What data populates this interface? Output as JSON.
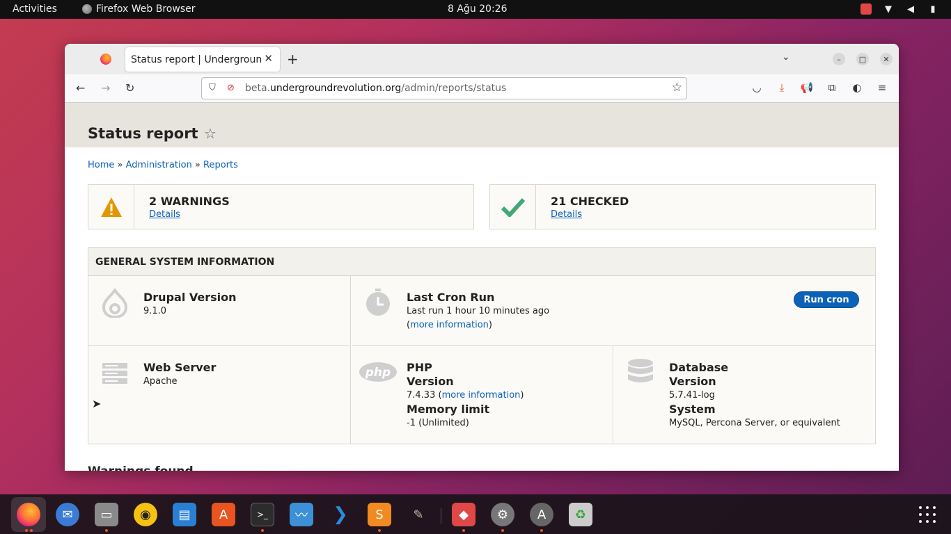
{
  "topbar": {
    "activities": "Activities",
    "app_name": "Firefox Web Browser",
    "clock": "8 Ağu  20:26"
  },
  "browser": {
    "tab_title": "Status report | Underground",
    "url_prefix": "beta.",
    "url_domain": "undergroundrevolution.org",
    "url_path": "/admin/reports/status"
  },
  "page": {
    "title": "Status report",
    "breadcrumb": [
      {
        "label": "Home"
      },
      {
        "label": "Administration"
      },
      {
        "label": "Reports"
      }
    ],
    "breadcrumb_sep": "»",
    "summary": {
      "warnings_title": "2 WARNINGS",
      "warnings_link": "Details",
      "checked_title": "21 CHECKED",
      "checked_link": "Details"
    },
    "general": {
      "heading": "GENERAL SYSTEM INFORMATION",
      "drupal_title": "Drupal Version",
      "drupal_value": "9.1.0",
      "cron_title": "Last Cron Run",
      "cron_text": "Last run 1 hour 10 minutes ago",
      "cron_link": "more information",
      "run_cron": "Run cron",
      "web_title": "Web Server",
      "web_value": "Apache",
      "php_title": "PHP",
      "php_version_label": "Version",
      "php_version_value": "7.4.33",
      "php_link": "more information",
      "php_memory_label": "Memory limit",
      "php_memory_value": "-1 (Unlimited)",
      "db_title": "Database",
      "db_version_label": "Version",
      "db_version_value": "5.7.41-log",
      "db_system_label": "System",
      "db_system_value": "MySQL, Percona Server, or equivalent",
      "php_logo_text": "php"
    },
    "warnings_found": "Warnings found"
  },
  "colors": {
    "link": "#0c61b8",
    "warning": "#e29700",
    "ok": "#42a877",
    "button": "#0c61b8"
  }
}
